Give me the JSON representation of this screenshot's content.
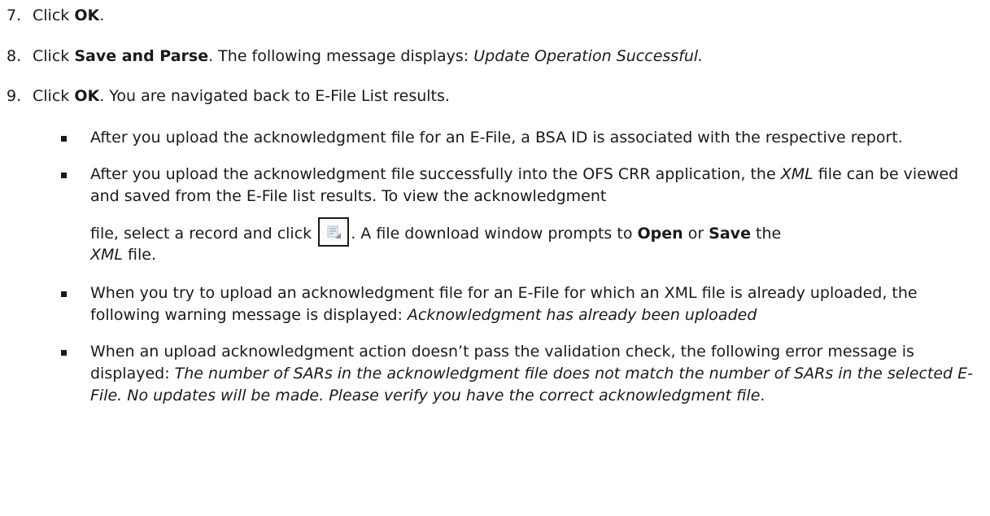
{
  "steps": [
    {
      "num": "7.",
      "pre": "Click ",
      "bold": "OK",
      "post": "."
    },
    {
      "num": "8.",
      "pre": "Click ",
      "bold": "Save and Parse",
      "mid": ". The following message displays: ",
      "italic": "Update Operation Successful."
    },
    {
      "num": "9.",
      "pre": "Click ",
      "bold": "OK",
      "post": ". You are navigated back to E-File List results."
    }
  ],
  "bullets": {
    "b1": {
      "text": "After you upload the acknowledgment file for an E-File, a BSA ID is associated with the respective report."
    },
    "b2": {
      "t1": "After you upload the acknowledgment file successfully into the OFS CRR application, the ",
      "i1": "XML",
      "t2": " file can be viewed and saved from the E-File list results. To view the acknowledgment",
      "t3": "file, select a record and click ",
      "t4": ". A file download window prompts to ",
      "b_open": "Open",
      "t5": " or ",
      "b_save": "Save",
      "t6": " the",
      "i2": "XML",
      "t7": " file.",
      "icon": "view-acknowledgment-icon"
    },
    "b3": {
      "t1": "When you try to upload an acknowledgment file for an E-File for which an XML file is already uploaded, the following warning message is displayed: ",
      "i1": "Acknowledgment has already been uploaded"
    },
    "b4": {
      "t1": "When an upload acknowledgment action doesn’t pass the validation check, the following error message is displayed: ",
      "i1": "The number of SARs in the acknowledgment file does not match the number of SARs in the selected E-File. No updates will be made. Please verify you have the correct acknowledgment file",
      "t2": "."
    }
  }
}
